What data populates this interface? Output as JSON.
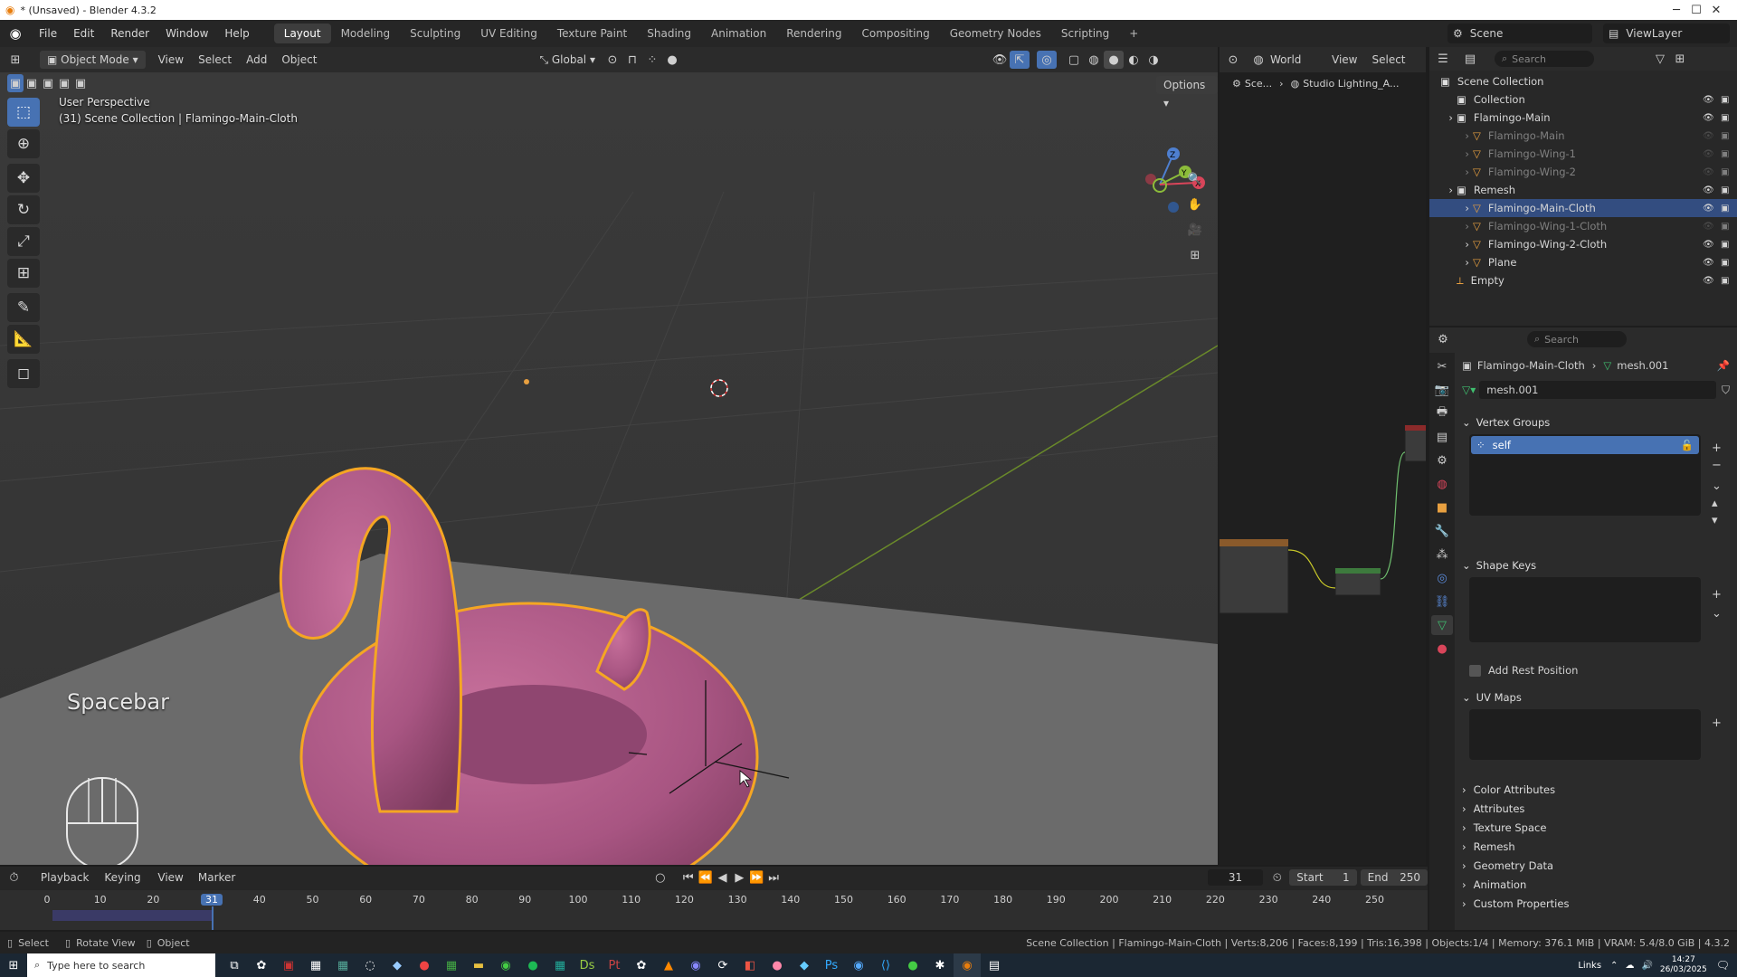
{
  "window": {
    "title": "* (Unsaved) - Blender 4.3.2",
    "controls": [
      "─",
      "☐",
      "✕"
    ]
  },
  "menu": {
    "items": [
      "File",
      "Edit",
      "Render",
      "Window",
      "Help"
    ],
    "workspaces": [
      "Layout",
      "Modeling",
      "Sculpting",
      "UV Editing",
      "Texture Paint",
      "Shading",
      "Animation",
      "Rendering",
      "Compositing",
      "Geometry Nodes",
      "Scripting"
    ],
    "add_tab": "+",
    "scene_label": "Scene",
    "viewlayer_label": "ViewLayer"
  },
  "viewport": {
    "mode": "Object Mode",
    "menus": [
      "View",
      "Select",
      "Add",
      "Object"
    ],
    "transform_orientation": "Global",
    "options_label": "Options",
    "perspective_label": "User Perspective",
    "collection_label": "(31) Scene Collection | Flamingo-Main-Cloth",
    "key_overlay": "Spacebar",
    "gizmo_axes": [
      "Z",
      "Y",
      "X"
    ]
  },
  "node_editor": {
    "world_label": "World",
    "menus": [
      "View",
      "Select"
    ],
    "breadcrumb": [
      "Sce...",
      "Studio Lighting_A..."
    ]
  },
  "outliner": {
    "search_placeholder": "Search",
    "rows": [
      {
        "label": "Scene Collection",
        "indent": 0,
        "type": "collection",
        "state": "normal"
      },
      {
        "label": "Collection",
        "indent": 1,
        "type": "collection",
        "state": "normal"
      },
      {
        "label": "Flamingo-Main",
        "indent": 1,
        "type": "collection",
        "state": "normal"
      },
      {
        "label": "Flamingo-Main",
        "indent": 2,
        "type": "mesh",
        "state": "dim"
      },
      {
        "label": "Flamingo-Wing-1",
        "indent": 2,
        "type": "mesh",
        "state": "dim"
      },
      {
        "label": "Flamingo-Wing-2",
        "indent": 2,
        "type": "mesh",
        "state": "dim"
      },
      {
        "label": "Remesh",
        "indent": 1,
        "type": "collection",
        "state": "normal"
      },
      {
        "label": "Flamingo-Main-Cloth",
        "indent": 2,
        "type": "mesh",
        "state": "selected"
      },
      {
        "label": "Flamingo-Wing-1-Cloth",
        "indent": 2,
        "type": "mesh",
        "state": "dim"
      },
      {
        "label": "Flamingo-Wing-2-Cloth",
        "indent": 2,
        "type": "mesh",
        "state": "normal"
      },
      {
        "label": "Plane",
        "indent": 2,
        "type": "mesh",
        "state": "normal"
      },
      {
        "label": "Empty",
        "indent": 1,
        "type": "empty",
        "state": "normal"
      }
    ]
  },
  "properties": {
    "search_placeholder": "Search",
    "object_name": "Flamingo-Main-Cloth",
    "mesh_name": "mesh.001",
    "datablock_name": "mesh.001",
    "vertex_groups_title": "Vertex Groups",
    "vertex_group_item": "self",
    "shape_keys_title": "Shape Keys",
    "add_rest_position": "Add Rest Position",
    "uv_maps_title": "UV Maps",
    "collapsed_panels": [
      "Color Attributes",
      "Attributes",
      "Texture Space",
      "Remesh",
      "Geometry Data",
      "Animation",
      "Custom Properties"
    ]
  },
  "timeline": {
    "menus": [
      "Playback",
      "Keying",
      "View",
      "Marker"
    ],
    "current_frame": "31",
    "start_label": "Start",
    "start_value": "1",
    "end_label": "End",
    "end_value": "250",
    "ticks": [
      "0",
      "10",
      "20",
      "31",
      "40",
      "50",
      "60",
      "70",
      "80",
      "90",
      "100",
      "110",
      "120",
      "130",
      "140",
      "150",
      "160",
      "170",
      "180",
      "190",
      "200",
      "210",
      "220",
      "230",
      "240",
      "250"
    ]
  },
  "statusbar": {
    "left": [
      "Select",
      "Rotate View",
      "Object"
    ],
    "info": "Scene Collection | Flamingo-Main-Cloth | Verts:8,206 | Faces:8,199 | Tris:16,398 | Objects:1/4 | Memory: 376.1 MiB | VRAM: 5.4/8.0 GiB | 4.3.2"
  },
  "taskbar": {
    "search_placeholder": "Type here to search",
    "tray_label": "Links",
    "time": "14:27",
    "date": "26/03/2025"
  },
  "colors": {
    "accent_blue": "#4772b3",
    "selection_orange": "#f5a623",
    "flamingo_pink": "#b65a8a",
    "outliner_selected": "#334d80"
  }
}
